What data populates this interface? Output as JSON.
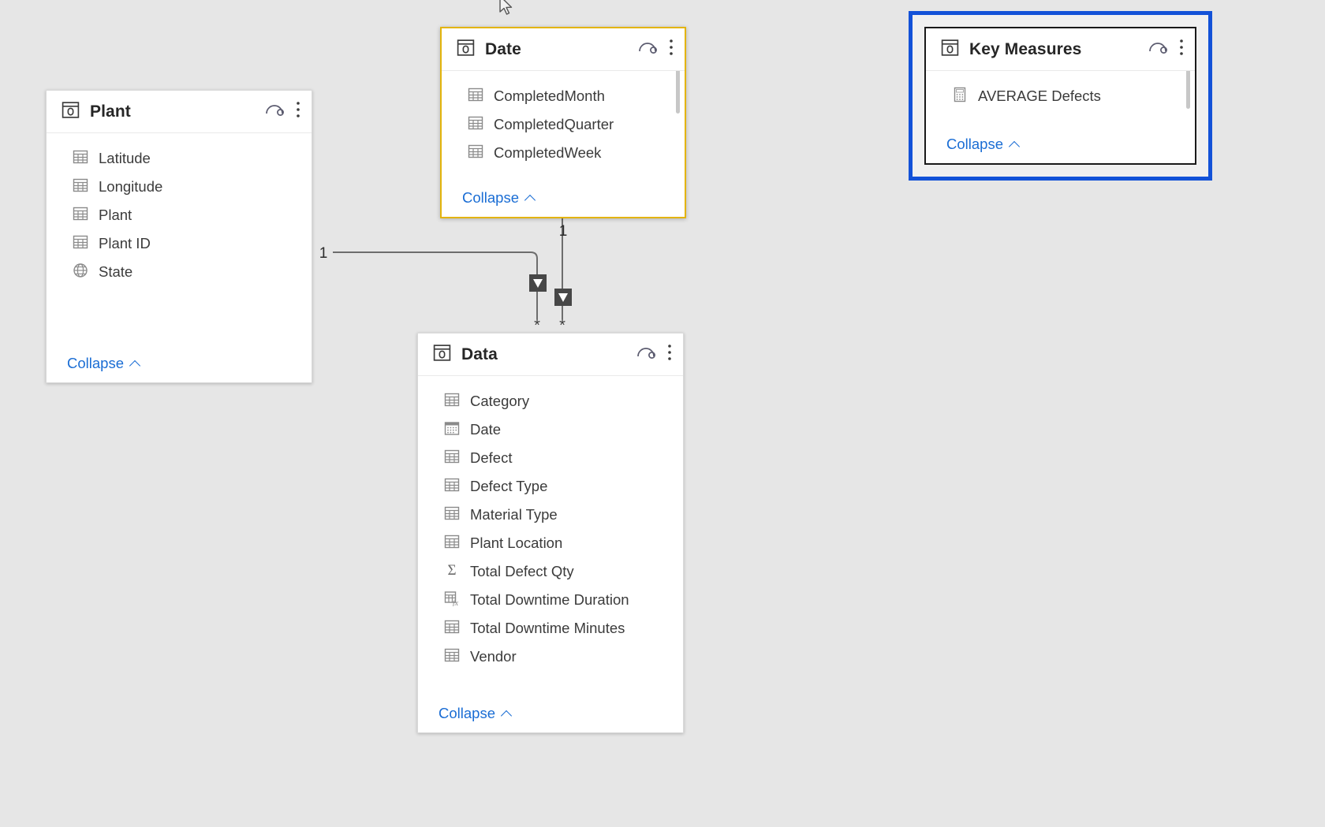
{
  "app": {
    "view_name": "model-view",
    "canvas_background": "#e6e6e6",
    "accent_link_color": "#1a6dd4",
    "selection_ring_color": "#1352d8",
    "focus_border_color": "#e3b40c"
  },
  "tables": [
    {
      "id": "plant",
      "title": "Plant",
      "state": "plain",
      "header_icons": [
        "table-card-icon",
        "eye-icon",
        "more-options-icon"
      ],
      "collapse_label": "Collapse",
      "fields": [
        {
          "name": "Latitude",
          "icon": "column-icon"
        },
        {
          "name": "Longitude",
          "icon": "column-icon"
        },
        {
          "name": "Plant",
          "icon": "column-icon"
        },
        {
          "name": "Plant ID",
          "icon": "column-icon"
        },
        {
          "name": "State",
          "icon": "globe-icon"
        }
      ]
    },
    {
      "id": "date",
      "title": "Date",
      "state": "focused",
      "header_icons": [
        "table-card-icon",
        "eye-icon",
        "more-options-icon"
      ],
      "collapse_label": "Collapse",
      "has_scrollbar": true,
      "fields": [
        {
          "name": "CompletedMonth",
          "icon": "column-icon"
        },
        {
          "name": "CompletedQuarter",
          "icon": "column-icon"
        },
        {
          "name": "CompletedWeek",
          "icon": "column-icon"
        }
      ]
    },
    {
      "id": "key-measures",
      "title": "Key Measures",
      "state": "selected",
      "header_icons": [
        "table-card-icon",
        "eye-icon",
        "more-options-icon"
      ],
      "collapse_label": "Collapse",
      "has_scrollbar": true,
      "fields": [
        {
          "name": "AVERAGE Defects",
          "icon": "measure-icon"
        }
      ]
    },
    {
      "id": "data",
      "title": "Data",
      "state": "plain",
      "header_icons": [
        "table-card-icon",
        "eye-icon",
        "more-options-icon"
      ],
      "collapse_label": "Collapse",
      "fields": [
        {
          "name": "Category",
          "icon": "column-icon"
        },
        {
          "name": "Date",
          "icon": "calendar-icon"
        },
        {
          "name": "Defect",
          "icon": "column-icon"
        },
        {
          "name": "Defect Type",
          "icon": "column-icon"
        },
        {
          "name": "Material Type",
          "icon": "column-icon"
        },
        {
          "name": "Plant Location",
          "icon": "column-icon"
        },
        {
          "name": "Total Defect Qty",
          "icon": "sigma-icon"
        },
        {
          "name": "Total Downtime Duration",
          "icon": "calculated-column-icon"
        },
        {
          "name": "Total Downtime Minutes",
          "icon": "column-icon"
        },
        {
          "name": "Vendor",
          "icon": "column-icon"
        }
      ]
    }
  ],
  "relationships": [
    {
      "id": "plant-to-data",
      "from_table": "Plant",
      "to_table": "Data",
      "from_cardinality": "1",
      "to_cardinality": "*",
      "cross_filter": "single"
    },
    {
      "id": "date-to-data",
      "from_table": "Date",
      "to_table": "Data",
      "from_cardinality": "1",
      "to_cardinality": "*",
      "cross_filter": "single"
    }
  ],
  "cursor": {
    "shape": "arrow-pointer"
  }
}
